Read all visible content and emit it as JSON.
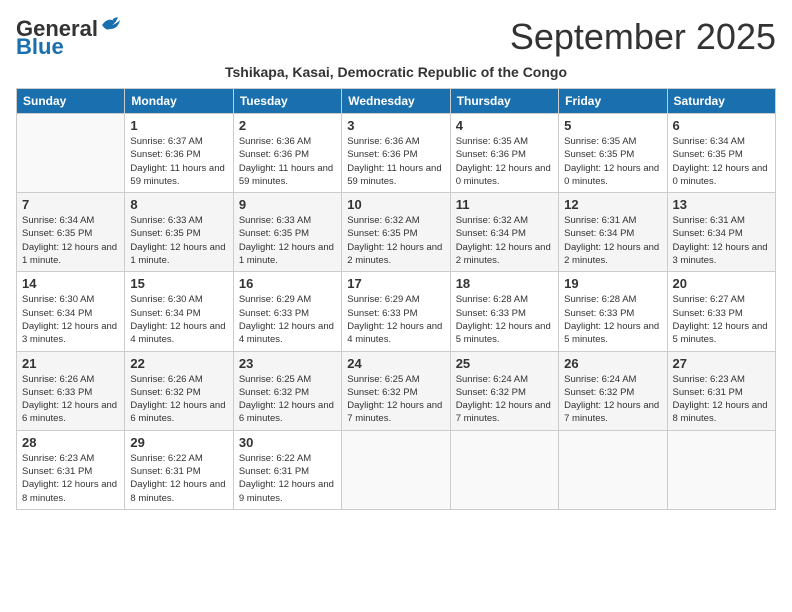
{
  "header": {
    "logo_general": "General",
    "logo_blue": "Blue",
    "month_title": "September 2025",
    "location": "Tshikapa, Kasai, Democratic Republic of the Congo"
  },
  "weekdays": [
    "Sunday",
    "Monday",
    "Tuesday",
    "Wednesday",
    "Thursday",
    "Friday",
    "Saturday"
  ],
  "weeks": [
    [
      {
        "day": "",
        "sunrise": "",
        "sunset": "",
        "daylight": ""
      },
      {
        "day": "1",
        "sunrise": "Sunrise: 6:37 AM",
        "sunset": "Sunset: 6:36 PM",
        "daylight": "Daylight: 11 hours and 59 minutes."
      },
      {
        "day": "2",
        "sunrise": "Sunrise: 6:36 AM",
        "sunset": "Sunset: 6:36 PM",
        "daylight": "Daylight: 11 hours and 59 minutes."
      },
      {
        "day": "3",
        "sunrise": "Sunrise: 6:36 AM",
        "sunset": "Sunset: 6:36 PM",
        "daylight": "Daylight: 11 hours and 59 minutes."
      },
      {
        "day": "4",
        "sunrise": "Sunrise: 6:35 AM",
        "sunset": "Sunset: 6:36 PM",
        "daylight": "Daylight: 12 hours and 0 minutes."
      },
      {
        "day": "5",
        "sunrise": "Sunrise: 6:35 AM",
        "sunset": "Sunset: 6:35 PM",
        "daylight": "Daylight: 12 hours and 0 minutes."
      },
      {
        "day": "6",
        "sunrise": "Sunrise: 6:34 AM",
        "sunset": "Sunset: 6:35 PM",
        "daylight": "Daylight: 12 hours and 0 minutes."
      }
    ],
    [
      {
        "day": "7",
        "sunrise": "Sunrise: 6:34 AM",
        "sunset": "Sunset: 6:35 PM",
        "daylight": "Daylight: 12 hours and 1 minute."
      },
      {
        "day": "8",
        "sunrise": "Sunrise: 6:33 AM",
        "sunset": "Sunset: 6:35 PM",
        "daylight": "Daylight: 12 hours and 1 minute."
      },
      {
        "day": "9",
        "sunrise": "Sunrise: 6:33 AM",
        "sunset": "Sunset: 6:35 PM",
        "daylight": "Daylight: 12 hours and 1 minute."
      },
      {
        "day": "10",
        "sunrise": "Sunrise: 6:32 AM",
        "sunset": "Sunset: 6:35 PM",
        "daylight": "Daylight: 12 hours and 2 minutes."
      },
      {
        "day": "11",
        "sunrise": "Sunrise: 6:32 AM",
        "sunset": "Sunset: 6:34 PM",
        "daylight": "Daylight: 12 hours and 2 minutes."
      },
      {
        "day": "12",
        "sunrise": "Sunrise: 6:31 AM",
        "sunset": "Sunset: 6:34 PM",
        "daylight": "Daylight: 12 hours and 2 minutes."
      },
      {
        "day": "13",
        "sunrise": "Sunrise: 6:31 AM",
        "sunset": "Sunset: 6:34 PM",
        "daylight": "Daylight: 12 hours and 3 minutes."
      }
    ],
    [
      {
        "day": "14",
        "sunrise": "Sunrise: 6:30 AM",
        "sunset": "Sunset: 6:34 PM",
        "daylight": "Daylight: 12 hours and 3 minutes."
      },
      {
        "day": "15",
        "sunrise": "Sunrise: 6:30 AM",
        "sunset": "Sunset: 6:34 PM",
        "daylight": "Daylight: 12 hours and 4 minutes."
      },
      {
        "day": "16",
        "sunrise": "Sunrise: 6:29 AM",
        "sunset": "Sunset: 6:33 PM",
        "daylight": "Daylight: 12 hours and 4 minutes."
      },
      {
        "day": "17",
        "sunrise": "Sunrise: 6:29 AM",
        "sunset": "Sunset: 6:33 PM",
        "daylight": "Daylight: 12 hours and 4 minutes."
      },
      {
        "day": "18",
        "sunrise": "Sunrise: 6:28 AM",
        "sunset": "Sunset: 6:33 PM",
        "daylight": "Daylight: 12 hours and 5 minutes."
      },
      {
        "day": "19",
        "sunrise": "Sunrise: 6:28 AM",
        "sunset": "Sunset: 6:33 PM",
        "daylight": "Daylight: 12 hours and 5 minutes."
      },
      {
        "day": "20",
        "sunrise": "Sunrise: 6:27 AM",
        "sunset": "Sunset: 6:33 PM",
        "daylight": "Daylight: 12 hours and 5 minutes."
      }
    ],
    [
      {
        "day": "21",
        "sunrise": "Sunrise: 6:26 AM",
        "sunset": "Sunset: 6:33 PM",
        "daylight": "Daylight: 12 hours and 6 minutes."
      },
      {
        "day": "22",
        "sunrise": "Sunrise: 6:26 AM",
        "sunset": "Sunset: 6:32 PM",
        "daylight": "Daylight: 12 hours and 6 minutes."
      },
      {
        "day": "23",
        "sunrise": "Sunrise: 6:25 AM",
        "sunset": "Sunset: 6:32 PM",
        "daylight": "Daylight: 12 hours and 6 minutes."
      },
      {
        "day": "24",
        "sunrise": "Sunrise: 6:25 AM",
        "sunset": "Sunset: 6:32 PM",
        "daylight": "Daylight: 12 hours and 7 minutes."
      },
      {
        "day": "25",
        "sunrise": "Sunrise: 6:24 AM",
        "sunset": "Sunset: 6:32 PM",
        "daylight": "Daylight: 12 hours and 7 minutes."
      },
      {
        "day": "26",
        "sunrise": "Sunrise: 6:24 AM",
        "sunset": "Sunset: 6:32 PM",
        "daylight": "Daylight: 12 hours and 7 minutes."
      },
      {
        "day": "27",
        "sunrise": "Sunrise: 6:23 AM",
        "sunset": "Sunset: 6:31 PM",
        "daylight": "Daylight: 12 hours and 8 minutes."
      }
    ],
    [
      {
        "day": "28",
        "sunrise": "Sunrise: 6:23 AM",
        "sunset": "Sunset: 6:31 PM",
        "daylight": "Daylight: 12 hours and 8 minutes."
      },
      {
        "day": "29",
        "sunrise": "Sunrise: 6:22 AM",
        "sunset": "Sunset: 6:31 PM",
        "daylight": "Daylight: 12 hours and 8 minutes."
      },
      {
        "day": "30",
        "sunrise": "Sunrise: 6:22 AM",
        "sunset": "Sunset: 6:31 PM",
        "daylight": "Daylight: 12 hours and 9 minutes."
      },
      {
        "day": "",
        "sunrise": "",
        "sunset": "",
        "daylight": ""
      },
      {
        "day": "",
        "sunrise": "",
        "sunset": "",
        "daylight": ""
      },
      {
        "day": "",
        "sunrise": "",
        "sunset": "",
        "daylight": ""
      },
      {
        "day": "",
        "sunrise": "",
        "sunset": "",
        "daylight": ""
      }
    ]
  ]
}
